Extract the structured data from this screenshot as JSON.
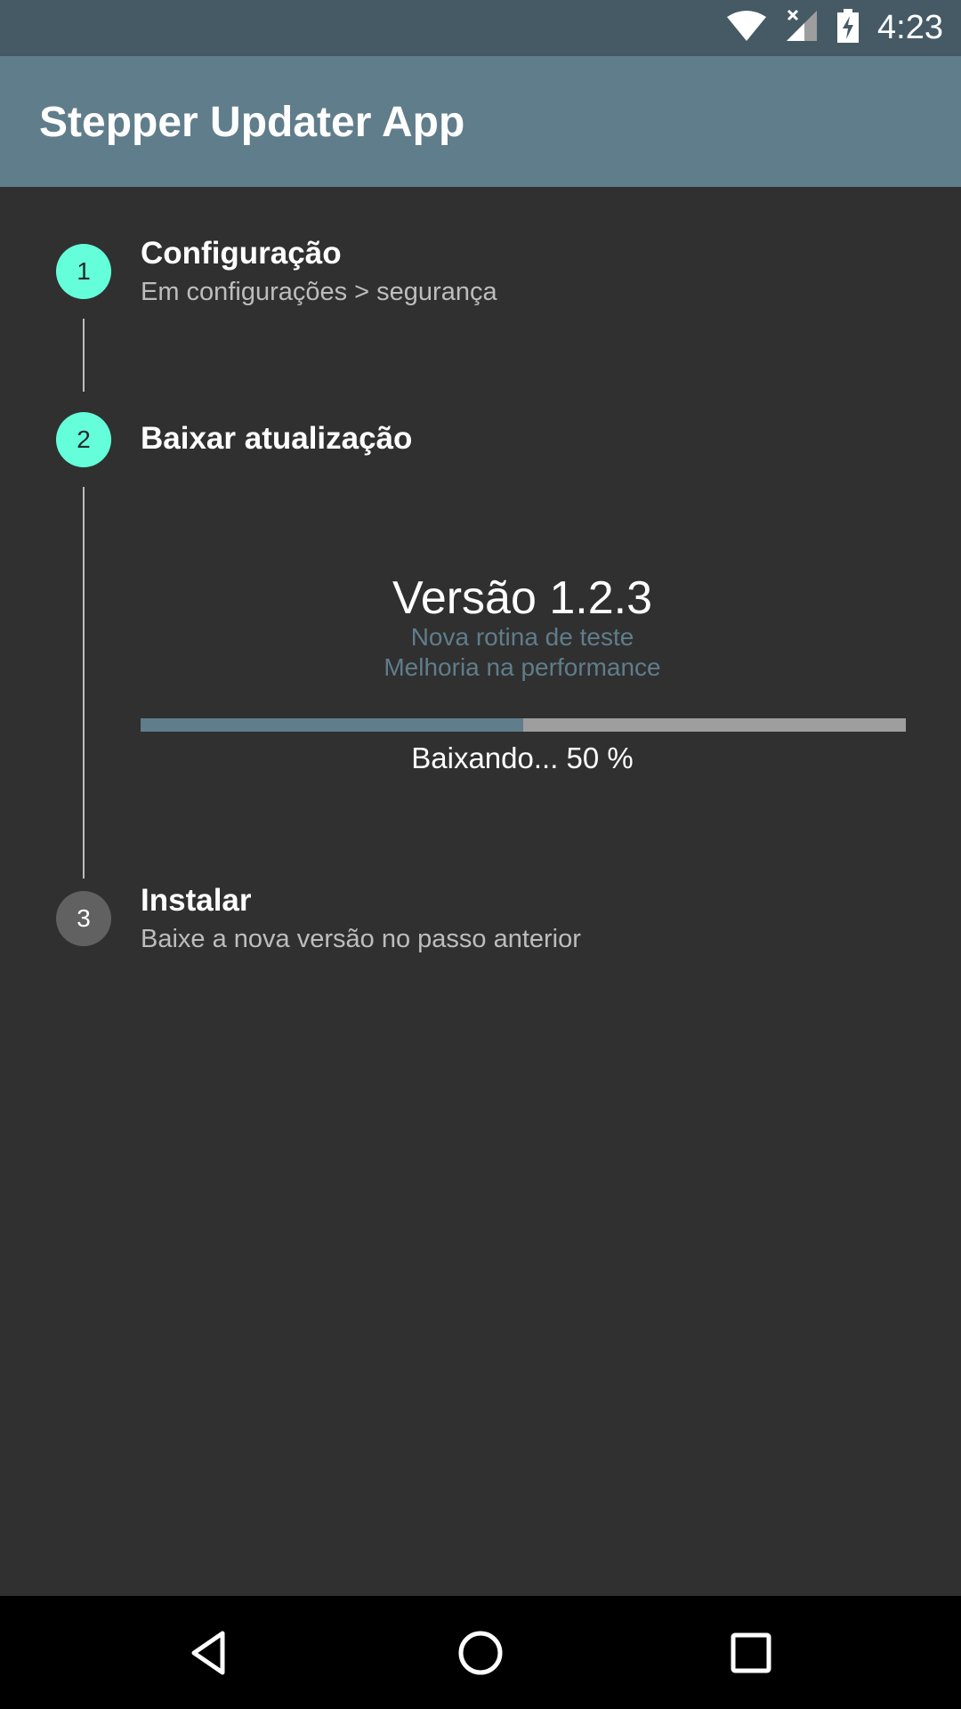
{
  "status_bar": {
    "time": "4:23",
    "icons": [
      "wifi-icon",
      "signal-icon",
      "battery-charging-icon"
    ]
  },
  "app_bar": {
    "title": "Stepper Updater App",
    "color": "#607d8b"
  },
  "steps": [
    {
      "number": "1",
      "title": "Configuração",
      "subtitle": "Em configurações > segurança",
      "state": "active"
    },
    {
      "number": "2",
      "title": "Baixar atualização",
      "state": "active",
      "content": {
        "version": "Versão 1.2.3",
        "notes": [
          "Nova rotina de teste",
          "Melhoria na performance"
        ],
        "progress_label": "Baixando... 50 %",
        "progress_fraction": 0.5
      }
    },
    {
      "number": "3",
      "title": "Instalar",
      "subtitle": "Baixe a nova versão no passo anterior",
      "state": "inactive"
    }
  ],
  "colors": {
    "accent": "#64ffda",
    "primary": "#607d8b",
    "primary_dark": "#455a64",
    "background": "#303030"
  },
  "nav_bar": {
    "buttons": [
      "back-icon",
      "home-icon",
      "recents-icon"
    ]
  }
}
